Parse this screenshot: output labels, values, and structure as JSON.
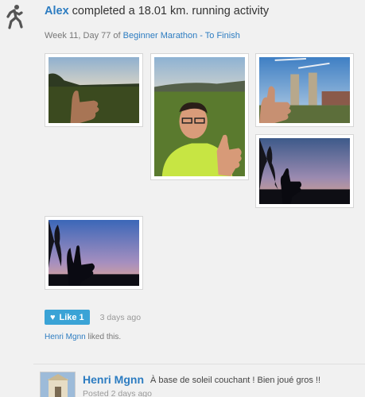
{
  "activity": {
    "user": "Alex",
    "action_text": "completed a 18.01 km. running activity",
    "week_day": "Week 11, Day 77 of",
    "plan_name": "Beginner Marathon - To Finish"
  },
  "icons": {
    "activity": "running-person-icon",
    "like": "heart-icon"
  },
  "like": {
    "label": "Like",
    "count": "1",
    "time": "3 days ago"
  },
  "liked_by": {
    "name": "Henri Mgnn",
    "suffix": "liked this."
  },
  "comment": {
    "author": "Henri Mgnn",
    "text": "À base de soleil couchant ! Bien joué gros !!",
    "time": "Posted 2 days ago"
  },
  "colors": {
    "link": "#2c7cc1",
    "like_button": "#3aa3d6",
    "background": "#f1f1f1"
  }
}
